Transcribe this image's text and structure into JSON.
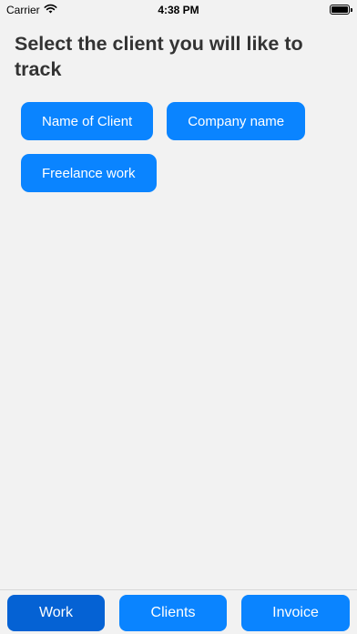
{
  "status_bar": {
    "carrier": "Carrier",
    "time": "4:38 PM",
    "wifi_icon": "wifi-icon",
    "battery_icon": "battery-icon"
  },
  "main": {
    "title": "Select the client you will like to track",
    "clients": [
      {
        "label": "Name of Client"
      },
      {
        "label": "Company name"
      },
      {
        "label": "Freelance work"
      }
    ]
  },
  "tabs": [
    {
      "label": "Work",
      "active": true
    },
    {
      "label": "Clients",
      "active": false
    },
    {
      "label": "Invoice",
      "active": false
    }
  ],
  "colors": {
    "accent": "#0a84ff",
    "accent_active": "#0562d4",
    "background": "#f2f2f2",
    "title_text": "#333333"
  }
}
